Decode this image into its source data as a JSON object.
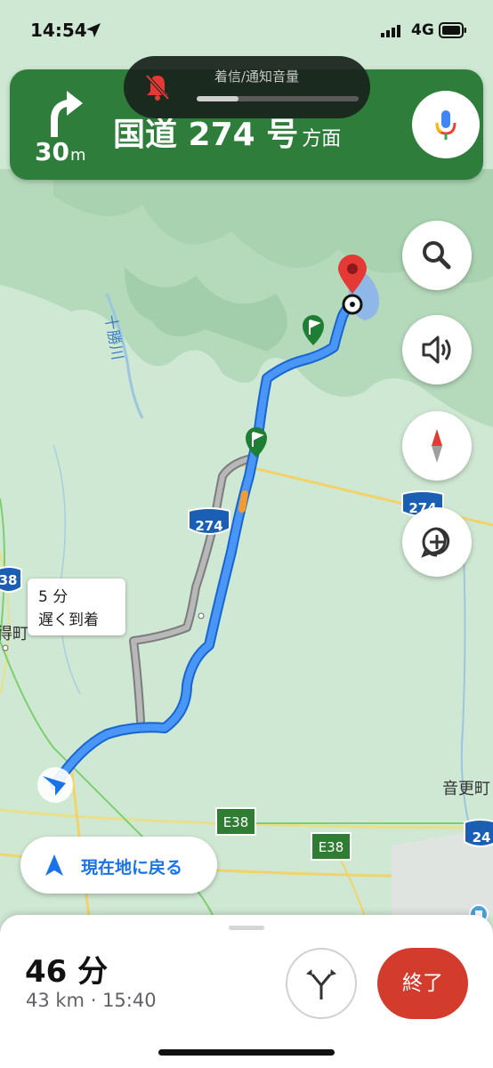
{
  "status_bar": {
    "time": "14:54",
    "network": "4G"
  },
  "volume_hud": {
    "label": "着信/通知音量",
    "level": 0.26
  },
  "nav_banner": {
    "distance": "30",
    "distance_unit": "m",
    "road": "国道 274 号",
    "road_suffix": "方面",
    "maneuver": "turn-right",
    "color": "#2e7d3a"
  },
  "map": {
    "river_label": "十勝川",
    "route_shield_274": "274",
    "route_shield_274_right": "274",
    "route_shield_24": "24",
    "route_shield_38": "38",
    "expressway_e38_a": "E38",
    "expressway_e38_b": "E38",
    "town_left": "得町",
    "town_right": "音更町",
    "alt_route_line1": "5 分",
    "alt_route_line2": "遅く到着"
  },
  "controls": {
    "recenter_label": "現在地に戻る"
  },
  "bottom_sheet": {
    "eta_duration": "46 分",
    "eta_detail": "43 km · 15:40",
    "exit_label": "終了"
  },
  "colors": {
    "route_blue": "#4285f4",
    "alt_route_gray": "#9e9e9e",
    "exit_red": "#d33b2c"
  }
}
